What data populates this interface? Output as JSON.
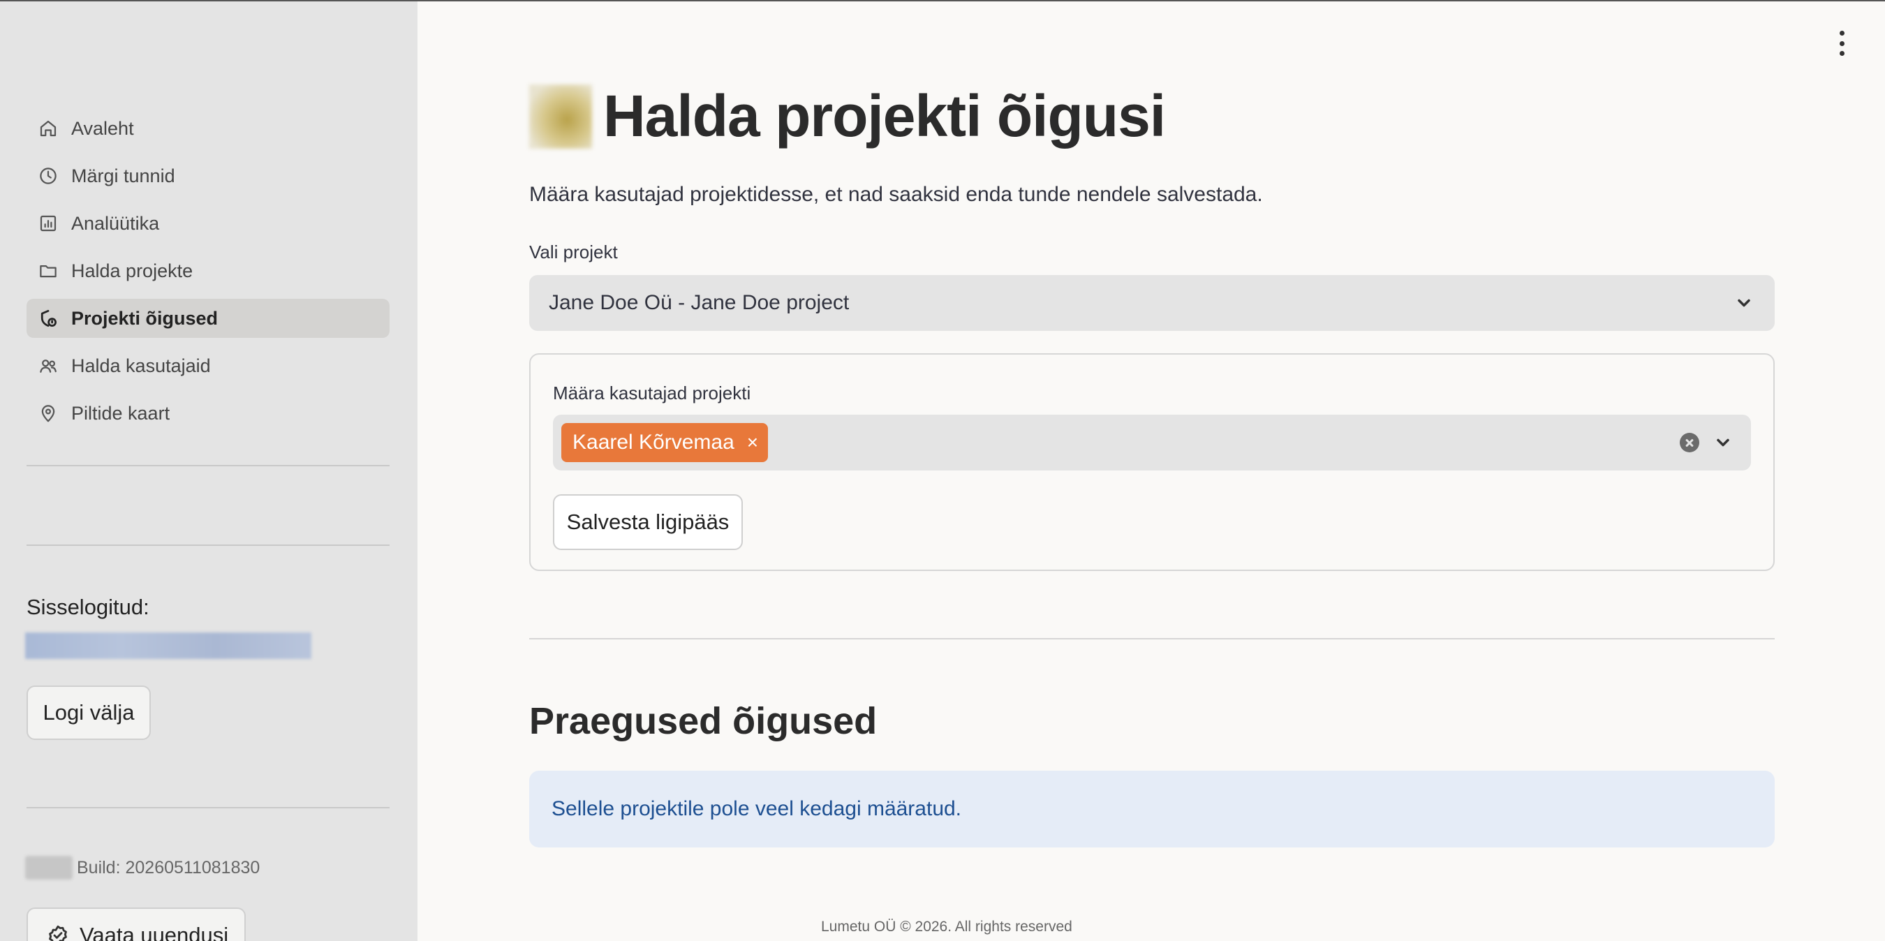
{
  "sidebar": {
    "items": [
      {
        "label": "Avaleht",
        "icon": "home-icon"
      },
      {
        "label": "Märgi tunnid",
        "icon": "clock-icon"
      },
      {
        "label": "Analüütika",
        "icon": "chart-icon"
      },
      {
        "label": "Halda projekte",
        "icon": "folder-icon"
      },
      {
        "label": "Projekti õigused",
        "icon": "shield-lock-icon",
        "active": true
      },
      {
        "label": "Halda kasutajaid",
        "icon": "users-icon"
      },
      {
        "label": "Piltide kaart",
        "icon": "map-pin-icon"
      }
    ],
    "logged_in_label": "Sisselogitud:",
    "logout_label": "Logi välja",
    "build_text": "Build: 20260511081830",
    "updates_label": "Vaata uuendusi"
  },
  "main": {
    "title": "Halda projekti õigusi",
    "subtitle": "Määra kasutajad projektidesse, et nad saaksid enda tunde nendele salvestada.",
    "project_select": {
      "label": "Vali projekt",
      "value": "Jane Doe Oü - Jane Doe project"
    },
    "assign": {
      "label": "Määra kasutajad projekti",
      "selected": [
        "Kaarel Kõrvemaa"
      ],
      "tag_remove": "×",
      "save_label": "Salvesta ligipääs"
    },
    "current_title": "Praegused õigused",
    "info_text": "Sellele projektile pole veel kedagi määratud."
  },
  "footer": {
    "text": "Lumetu OÜ © 2026. All rights reserved"
  },
  "colors": {
    "accent": "#e8783a",
    "sidebar_bg": "#e4e4e4",
    "page_bg": "#faf9f7",
    "info_bg": "#e5ecf7",
    "info_text": "#1d4f91"
  }
}
